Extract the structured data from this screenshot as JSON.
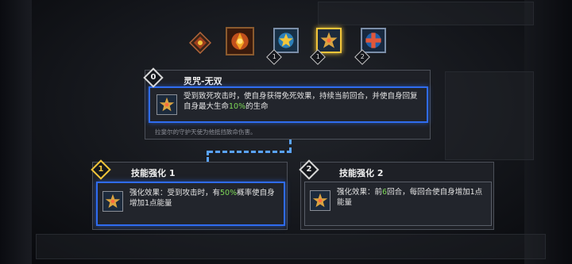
{
  "skill_row": {
    "level_badges": [
      "1",
      "1",
      "2"
    ]
  },
  "main_panel": {
    "level": "0",
    "title": "灵咒-无双",
    "desc_part1": "受到致死攻击时，使自身获得免死效果，持续当前回合，并使自身回复自身最大生命",
    "desc_highlight": "10%",
    "desc_part2": "的生命",
    "flavor": "拉斐尔的守护天使为他抵挡致命伤害。"
  },
  "enh1": {
    "level": "1",
    "title": "技能强化 1",
    "desc_part1": "强化效果：受到攻击时，有",
    "desc_highlight": "50%",
    "desc_part2": "概率使自身增加1点能量"
  },
  "enh2": {
    "level": "2",
    "title": "技能强化 2",
    "desc_part1": "强化效果：前",
    "desc_highlight": "6",
    "desc_part2": "回合，每回合使自身增加1点能量"
  },
  "colors": {
    "accent_blue": "#2f6cf0",
    "highlight_green": "#7ed957",
    "gold": "#f2c53a"
  }
}
